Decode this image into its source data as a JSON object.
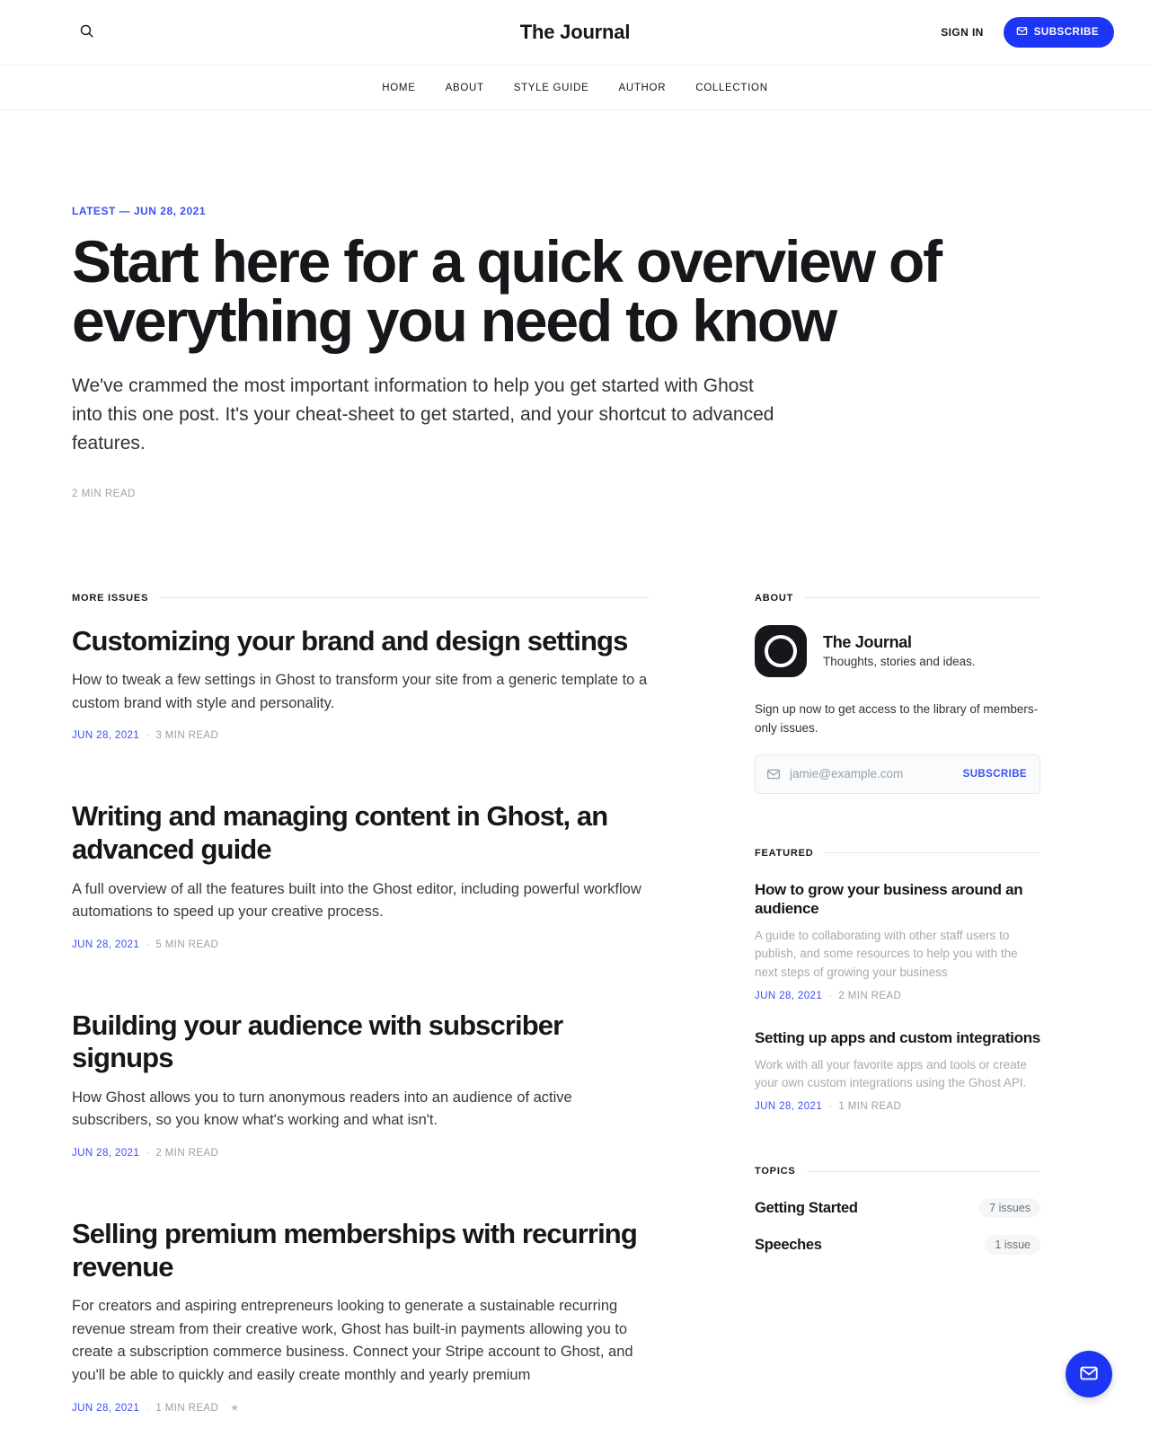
{
  "header": {
    "site_title": "The Journal",
    "search_icon": "search-icon",
    "sign_in_label": "SIGN IN",
    "subscribe_label": "SUBSCRIBE",
    "subscribe_icon": "mail-icon",
    "accent_color": "#1d36f5",
    "nav": [
      {
        "label": "HOME"
      },
      {
        "label": "ABOUT"
      },
      {
        "label": "STYLE GUIDE"
      },
      {
        "label": "AUTHOR"
      },
      {
        "label": "COLLECTION"
      }
    ]
  },
  "hero": {
    "kicker": "LATEST — JUN 28, 2021",
    "title": "Start here for a quick overview of everything you need to know",
    "excerpt": "We've crammed the most important information to help you get started with Ghost into this one post. It's your cheat-sheet to get started, and your shortcut to advanced features.",
    "read_time": "2 MIN READ"
  },
  "more_issues": {
    "label": "MORE ISSUES",
    "articles": [
      {
        "title": "Customizing your brand and design settings",
        "excerpt": "How to tweak a few settings in Ghost to transform your site from a generic template to a custom brand with style and personality.",
        "date": "JUN 28, 2021",
        "separator": "·",
        "read_time": "3 MIN READ",
        "star": ""
      },
      {
        "title": "Writing and managing content in Ghost, an advanced guide",
        "excerpt": "A full overview of all the features built into the Ghost editor, including powerful workflow automations to speed up your creative process.",
        "date": "JUN 28, 2021",
        "separator": "·",
        "read_time": "5 MIN READ",
        "star": ""
      },
      {
        "title": "Building your audience with subscriber signups",
        "excerpt": "How Ghost allows you to turn anonymous readers into an audience of active subscribers, so you know what's working and what isn't.",
        "date": "JUN 28, 2021",
        "separator": "·",
        "read_time": "2 MIN READ",
        "star": ""
      },
      {
        "title": "Selling premium memberships with recurring revenue",
        "excerpt": "For creators and aspiring entrepreneurs looking to generate a sustainable recurring revenue stream from their creative work, Ghost has built-in payments allowing you to create a subscription commerce business. Connect your Stripe account to Ghost, and you'll be able to quickly and easily create monthly and yearly premium",
        "date": "JUN 28, 2021",
        "separator": "·",
        "read_time": "1 MIN READ",
        "star": "★"
      }
    ]
  },
  "sidebar": {
    "about": {
      "label": "ABOUT",
      "logo_icon": "ghost-logo-icon",
      "name": "The Journal",
      "tagline": "Thoughts, stories and ideas.",
      "blurb": "Sign up now to get access to the library of members-only issues.",
      "email_placeholder": "jamie@example.com",
      "email_value": "",
      "mail_icon": "mail-icon",
      "subscribe_label": "SUBSCRIBE"
    },
    "featured": {
      "label": "FEATURED",
      "items": [
        {
          "title": "How to grow your business around an audience",
          "excerpt": "A guide to collaborating with other staff users to publish, and some resources to help you with the next steps of growing your business",
          "date": "JUN 28, 2021",
          "separator": "·",
          "read_time": "2 MIN READ"
        },
        {
          "title": "Setting up apps and custom integrations",
          "excerpt": "Work with all your favorite apps and tools or create your own custom integrations using the Ghost API.",
          "date": "JUN 28, 2021",
          "separator": "·",
          "read_time": "1 MIN READ"
        }
      ]
    },
    "topics": {
      "label": "TOPICS",
      "items": [
        {
          "name": "Getting Started",
          "count": "7 issues"
        },
        {
          "name": "Speeches",
          "count": "1 issue"
        }
      ]
    }
  },
  "floating_button": {
    "icon": "mail-icon"
  }
}
